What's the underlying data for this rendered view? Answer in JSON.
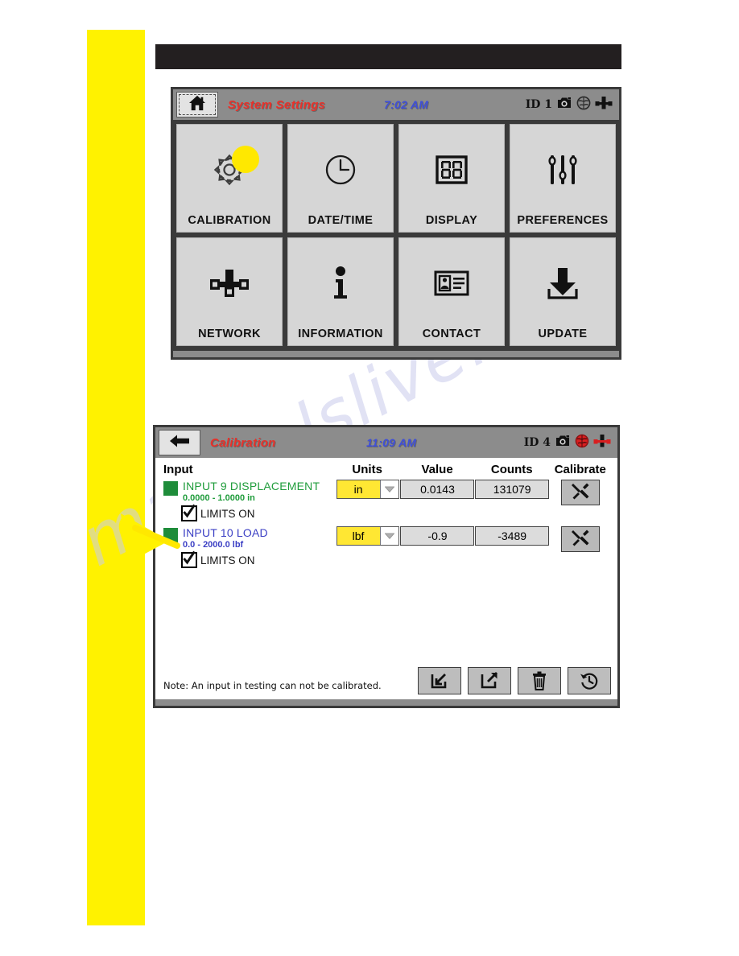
{
  "annotations": {
    "highlight_bar_color": "#fff200",
    "callout_dot_color": "#ffe800"
  },
  "watermark": {
    "text": "manualslive.com"
  },
  "screen1": {
    "header": {
      "home_button": "home-icon",
      "title": "System Settings",
      "time": "7:02 AM",
      "id_label": "ID 1",
      "icons": [
        "camera-icon",
        "globe-icon",
        "network-icon"
      ]
    },
    "tiles": [
      {
        "label": "CALIBRATION",
        "icon": "gear-icon",
        "highlighted": true
      },
      {
        "label": "DATE/TIME",
        "icon": "clock-icon",
        "highlighted": false
      },
      {
        "label": "DISPLAY",
        "icon": "seven-segment-icon",
        "highlighted": false
      },
      {
        "label": "PREFERENCES",
        "icon": "sliders-icon",
        "highlighted": false
      },
      {
        "label": "NETWORK",
        "icon": "network-icon",
        "highlighted": false
      },
      {
        "label": "INFORMATION",
        "icon": "info-icon",
        "highlighted": false
      },
      {
        "label": "CONTACT",
        "icon": "contact-card-icon",
        "highlighted": false
      },
      {
        "label": "UPDATE",
        "icon": "download-icon",
        "highlighted": false
      }
    ]
  },
  "screen2": {
    "header": {
      "back_button": "back-arrow-icon",
      "title": "Calibration",
      "time": "11:09 AM",
      "id_label": "ID 4",
      "icons": [
        "camera-icon",
        "globe-icon-red",
        "network-icon-red"
      ]
    },
    "columns": {
      "input": "Input",
      "units": "Units",
      "value": "Value",
      "counts": "Counts",
      "calibrate": "Calibrate"
    },
    "rows": [
      {
        "name": "INPUT 9 DISPLACEMENT",
        "range": "0.0000 - 1.0000 in",
        "name_color": "#1f9c3b",
        "limits_label": "LIMITS ON",
        "limits_checked": true,
        "units": "in",
        "value": "0.0143",
        "counts": "131079",
        "calibrate_icon": "wrench-screwdriver-icon",
        "status_color": "#1e8c3a"
      },
      {
        "name": "INPUT 10 LOAD",
        "range": "0.0 - 2000.0 lbf",
        "name_color": "#3b3fc4",
        "limits_label": "LIMITS ON",
        "limits_checked": true,
        "units": "lbf",
        "value": "-0.9",
        "counts": "-3489",
        "calibrate_icon": "wrench-screwdriver-icon",
        "status_color": "#1e8c3a"
      }
    ],
    "note": "Note:  An input in testing can not be calibrated.",
    "footer_buttons": [
      {
        "name": "import-button",
        "icon": "arrow-in-icon"
      },
      {
        "name": "export-button",
        "icon": "arrow-out-icon"
      },
      {
        "name": "delete-button",
        "icon": "trash-icon"
      },
      {
        "name": "restore-button",
        "icon": "history-icon"
      }
    ]
  }
}
